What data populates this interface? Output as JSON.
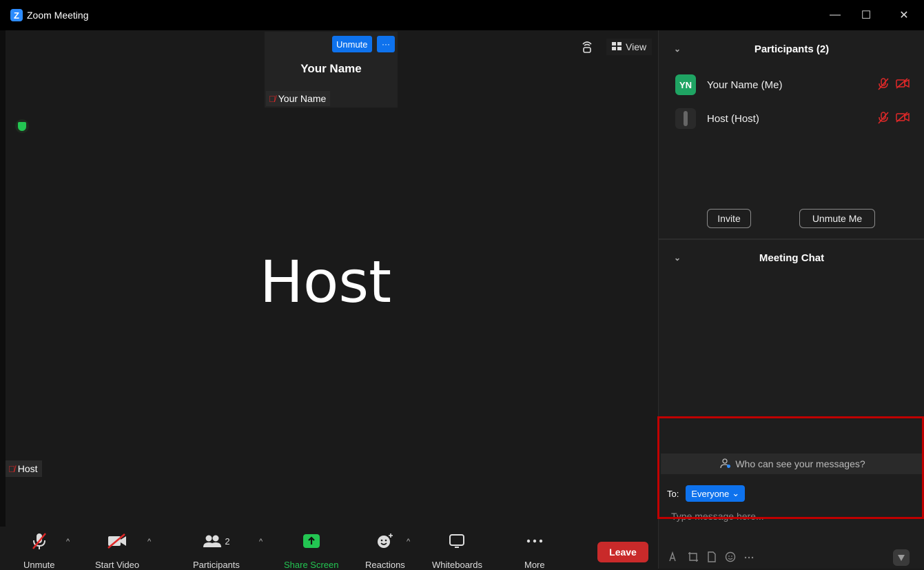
{
  "window": {
    "title": "Zoom Meeting",
    "logo": "Z",
    "minimize": "—",
    "maximize": "☐",
    "close": "✕"
  },
  "self_tile": {
    "unmute_label": "Unmute",
    "more_label": "···",
    "name_big": "Your Name",
    "name_label": "Your Name"
  },
  "stage": {
    "view_label": "View",
    "speaker_name": "Host",
    "speaker_label": "Host"
  },
  "toolbar": {
    "unmute": "Unmute",
    "start_video": "Start Video",
    "participants": "Participants",
    "participants_count": "2",
    "share_screen": "Share Screen",
    "reactions": "Reactions",
    "whiteboards": "Whiteboards",
    "more": "More",
    "leave": "Leave"
  },
  "participants_panel": {
    "title": "Participants (2)",
    "items": [
      {
        "initials": "YN",
        "name": "Your Name (Me)"
      },
      {
        "initials": "",
        "name": "Host (Host)"
      }
    ],
    "invite": "Invite",
    "unmute_me": "Unmute Me"
  },
  "chat_panel": {
    "title": "Meeting Chat",
    "who_can_see": "Who can see your messages?",
    "to_label": "To:",
    "recipient": "Everyone",
    "placeholder": "Type message here..."
  },
  "colors": {
    "accent": "#0e72ed",
    "leave": "#c92a2a",
    "share": "#23c552",
    "muted": "#e02828",
    "highlight": "#c00000"
  }
}
